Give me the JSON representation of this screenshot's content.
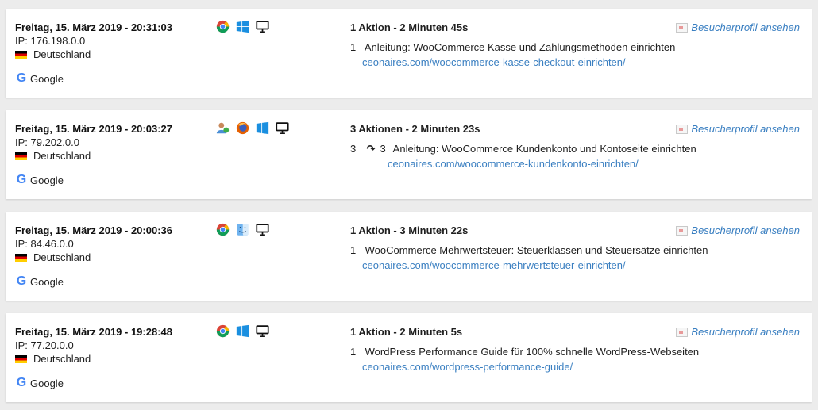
{
  "colors": {
    "link": "#3a7fc1",
    "background": "#ececec",
    "card": "#ffffff"
  },
  "visits": [
    {
      "datetime": "Freitag, 15. März 2019 - 20:31:03",
      "ip": "IP: 176.198.0.0",
      "country": "Deutschland",
      "source": "Google",
      "icons": [
        "chrome-icon",
        "windows-icon",
        "desktop-icon"
      ],
      "summary": "1 Aktion - 2 Minuten 45s",
      "profile_link": "Besucherprofil ansehen",
      "action_num": "1",
      "action_title": "Anleitung: WooCommerce Kasse und Zahlungsmethoden einrichten",
      "action_url": "ceonaires.com/woocommerce-kasse-checkout-einrichten/"
    },
    {
      "datetime": "Freitag, 15. März 2019 - 20:03:27",
      "ip": "IP: 79.202.0.0",
      "country": "Deutschland",
      "source": "Google",
      "icons": [
        "returning-visitor-icon",
        "firefox-icon",
        "windows-icon",
        "desktop-icon"
      ],
      "summary": "3 Aktionen - 2 Minuten 23s",
      "profile_link": "Besucherprofil ansehen",
      "action_num": "3",
      "action_repeat": "3",
      "action_title": "Anleitung: WooCommerce Kundenkonto und Kontoseite einrichten",
      "action_url": "ceonaires.com/woocommerce-kundenkonto-einrichten/"
    },
    {
      "datetime": "Freitag, 15. März 2019 - 20:00:36",
      "ip": "IP: 84.46.0.0",
      "country": "Deutschland",
      "source": "Google",
      "icons": [
        "chrome-icon",
        "mac-finder-icon",
        "desktop-icon"
      ],
      "summary": "1 Aktion - 3 Minuten 22s",
      "profile_link": "Besucherprofil ansehen",
      "action_num": "1",
      "action_title": "WooCommerce Mehrwertsteuer: Steuerklassen und Steuersätze einrichten",
      "action_url": "ceonaires.com/woocommerce-mehrwertsteuer-einrichten/"
    },
    {
      "datetime": "Freitag, 15. März 2019 - 19:28:48",
      "ip": "IP: 77.20.0.0",
      "country": "Deutschland",
      "source": "Google",
      "icons": [
        "chrome-icon",
        "windows-icon",
        "desktop-icon"
      ],
      "summary": "1 Aktion - 2 Minuten 5s",
      "profile_link": "Besucherprofil ansehen",
      "action_num": "1",
      "action_title": "WordPress Performance Guide für 100% schnelle WordPress-Webseiten",
      "action_url": "ceonaires.com/wordpress-performance-guide/"
    }
  ]
}
